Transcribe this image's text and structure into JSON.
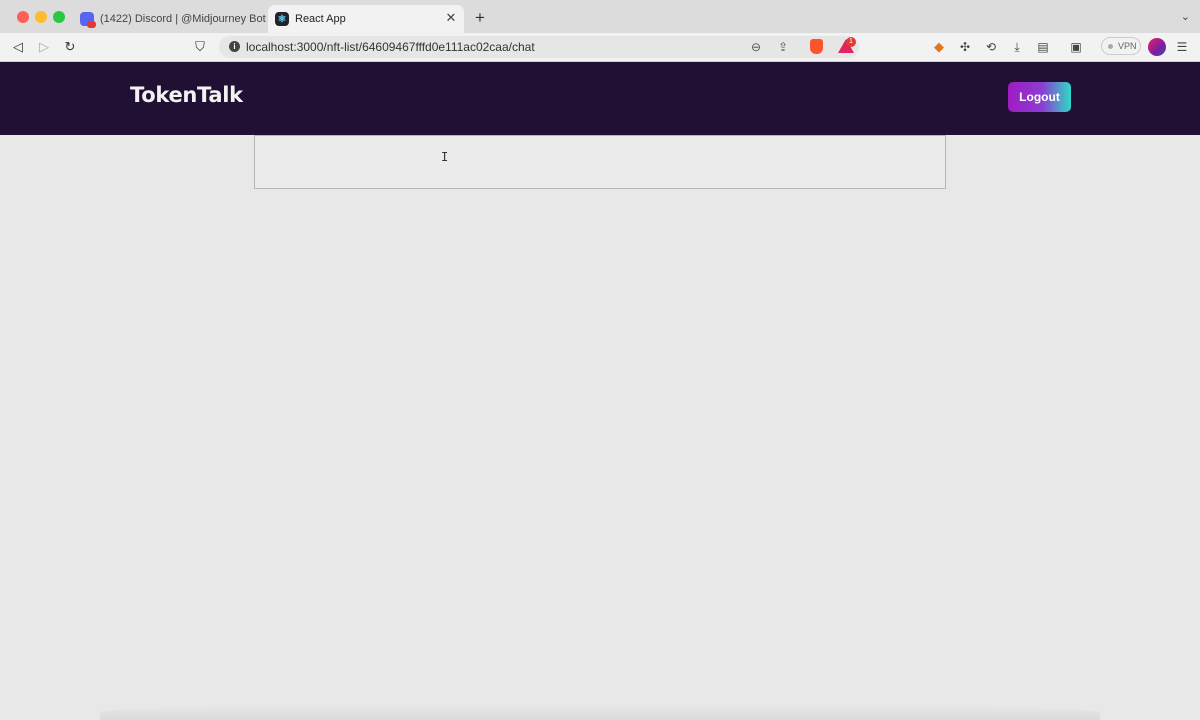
{
  "browser": {
    "tabs": [
      {
        "title": "(1422) Discord | @Midjourney Bot",
        "favicon": "discord-icon",
        "active": false
      },
      {
        "title": "React App",
        "favicon": "react-icon",
        "active": true
      }
    ],
    "new_tab_label": "+",
    "url": "localhost:3000/nft-list/64609467fffd0e111ac02caa/chat",
    "vpn_label": "VPN",
    "rewards_badge": "1"
  },
  "app": {
    "brand": "TokenTalk",
    "logout_label": "Logout",
    "header_color": "#201034",
    "accent_gradient": [
      "#a01bc4",
      "#2fd9c6"
    ],
    "chat_input_value": ""
  }
}
